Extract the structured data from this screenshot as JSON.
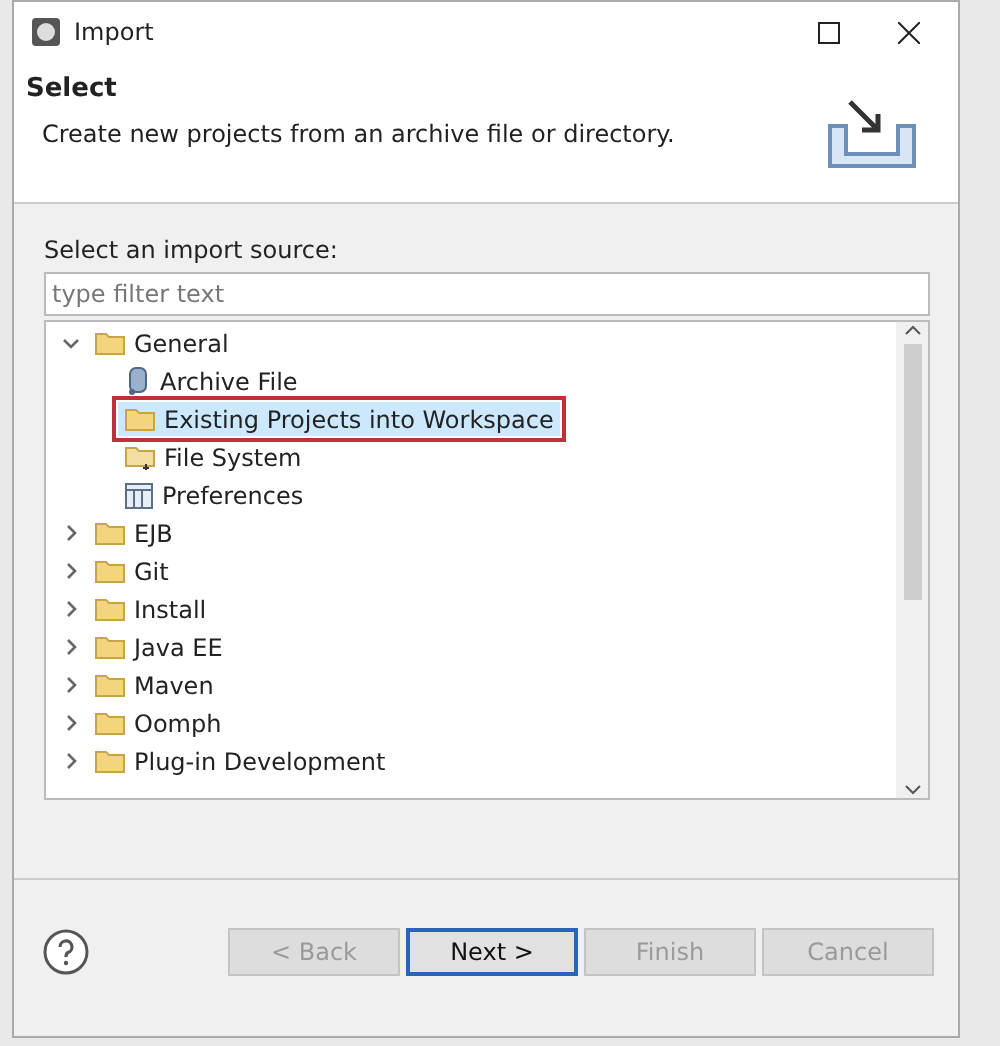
{
  "window": {
    "title": "Import"
  },
  "header": {
    "title": "Select",
    "description": "Create new projects from an archive file or directory."
  },
  "source": {
    "label": "Select an import source:",
    "placeholder": "type filter text"
  },
  "tree": [
    {
      "label": "General",
      "kind": "folder",
      "expanded": true,
      "selected": false,
      "children": [
        {
          "label": "Archive File",
          "kind": "archive",
          "selected": false,
          "marked": false
        },
        {
          "label": "Existing Projects into Workspace",
          "kind": "folder",
          "selected": true,
          "marked": true
        },
        {
          "label": "File System",
          "kind": "filesystem",
          "selected": false,
          "marked": false
        },
        {
          "label": "Preferences",
          "kind": "preferences",
          "selected": false,
          "marked": false
        }
      ]
    },
    {
      "label": "EJB",
      "kind": "folder",
      "expanded": false,
      "selected": false
    },
    {
      "label": "Git",
      "kind": "folder",
      "expanded": false,
      "selected": false
    },
    {
      "label": "Install",
      "kind": "folder",
      "expanded": false,
      "selected": false
    },
    {
      "label": "Java EE",
      "kind": "folder",
      "expanded": false,
      "selected": false
    },
    {
      "label": "Maven",
      "kind": "folder",
      "expanded": false,
      "selected": false
    },
    {
      "label": "Oomph",
      "kind": "folder",
      "expanded": false,
      "selected": false
    },
    {
      "label": "Plug-in Development",
      "kind": "folder",
      "expanded": false,
      "selected": false
    }
  ],
  "buttons": [
    {
      "label": "< Back",
      "disabled": true,
      "default": false
    },
    {
      "label": "Next >",
      "disabled": false,
      "default": true
    },
    {
      "label": "Finish",
      "disabled": true,
      "default": false
    },
    {
      "label": "Cancel",
      "disabled": true,
      "default": false
    }
  ]
}
